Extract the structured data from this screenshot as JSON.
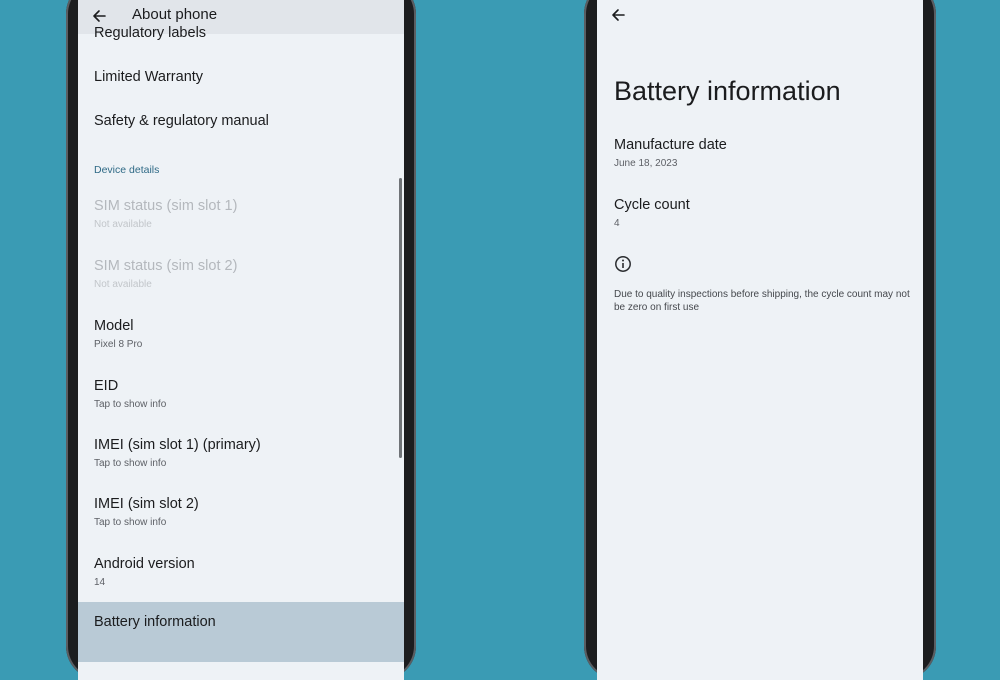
{
  "colors": {
    "background": "#3a9bb4",
    "screen": "#eef2f6",
    "section_header": "#2f6a86",
    "highlight": "#b9cad6"
  },
  "left_screen": {
    "appbar": {
      "back_icon": "arrow-back-icon",
      "title": "About phone"
    },
    "items": [
      {
        "title": "Regulatory labels"
      },
      {
        "title": "Limited Warranty"
      },
      {
        "title": "Safety & regulatory manual"
      }
    ],
    "section_header": "Device details",
    "details": [
      {
        "title": "SIM status (sim slot 1)",
        "subtitle": "Not available",
        "disabled": true
      },
      {
        "title": "SIM status (sim slot 2)",
        "subtitle": "Not available",
        "disabled": true
      },
      {
        "title": "Model",
        "subtitle": "Pixel 8 Pro"
      },
      {
        "title": "EID",
        "subtitle": "Tap to show info"
      },
      {
        "title": "IMEI (sim slot 1) (primary)",
        "subtitle": "Tap to show info"
      },
      {
        "title": "IMEI (sim slot 2)",
        "subtitle": "Tap to show info"
      },
      {
        "title": "Android version",
        "subtitle": "14"
      }
    ],
    "highlighted_item": {
      "title": "Battery information"
    }
  },
  "right_screen": {
    "back_icon": "arrow-back-icon",
    "title": "Battery information",
    "manufacture_date": {
      "title": "Manufacture date",
      "value": "June 18, 2023"
    },
    "cycle_count": {
      "title": "Cycle count",
      "value": "4"
    },
    "info_icon": "info-icon",
    "note": "Due to quality inspections before shipping, the cycle count may not be zero on first use"
  }
}
